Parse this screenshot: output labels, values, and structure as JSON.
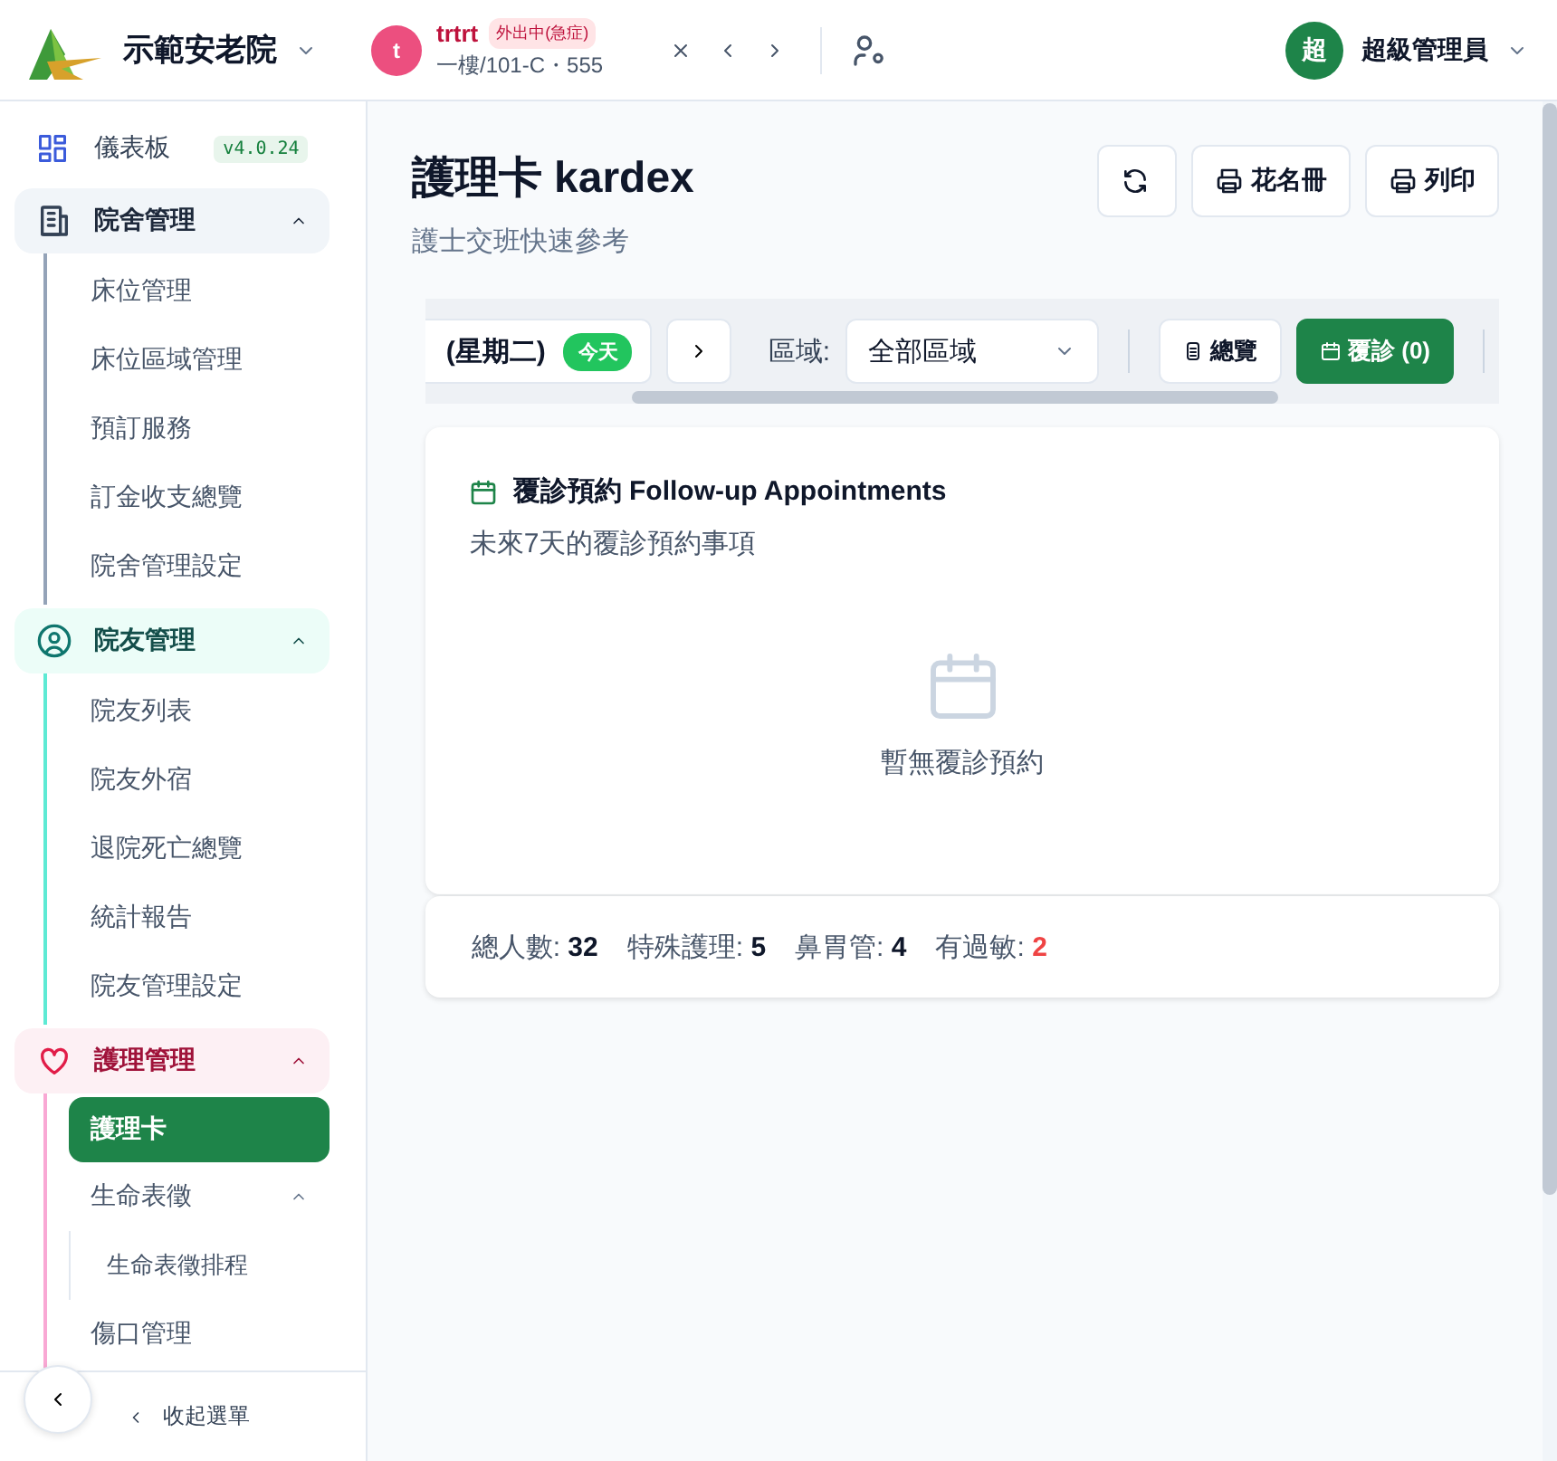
{
  "header": {
    "org_name": "示範安老院",
    "patient": {
      "avatar": "t",
      "name": "trtrt",
      "status": "外出中(急症)",
      "location": "一樓/101-C・555"
    },
    "user": {
      "avatar": "超",
      "name": "超級管理員"
    }
  },
  "sidebar": {
    "items": [
      {
        "kind": "link",
        "label": "儀表板",
        "badge": "v4.0.24"
      },
      {
        "kind": "group",
        "label": "院舍管理",
        "expanded": true,
        "color": "#94a3b8",
        "children": [
          {
            "label": "床位管理",
            "selected": false
          },
          {
            "label": "床位區域管理",
            "selected": false
          },
          {
            "label": "預訂服務",
            "selected": false
          },
          {
            "label": "訂金收支總覽",
            "selected": false
          },
          {
            "label": "院舍管理設定",
            "selected": false
          }
        ]
      },
      {
        "kind": "group",
        "label": "院友管理",
        "expanded": true,
        "color": "#5eead4",
        "children": [
          {
            "label": "院友列表",
            "selected": false
          },
          {
            "label": "院友外宿",
            "selected": false
          },
          {
            "label": "退院死亡總覽",
            "selected": false
          },
          {
            "label": "統計報告",
            "selected": false
          },
          {
            "label": "院友管理設定",
            "selected": false
          }
        ]
      },
      {
        "kind": "group",
        "label": "護理管理",
        "expanded": true,
        "color": "#f9a8d4",
        "children": [
          {
            "label": "護理卡",
            "selected": true
          },
          {
            "label": "生命表徵",
            "selected": false,
            "expanded": true,
            "children": [
              {
                "label": "生命表徵排程",
                "selected": false
              }
            ]
          },
          {
            "label": "傷口管理",
            "selected": false
          }
        ]
      }
    ],
    "collapse_label": "收起選單"
  },
  "page": {
    "title": "護理卡 kardex",
    "subtitle": "護士交班快速參考",
    "actions": [
      {
        "kind": "refresh"
      },
      {
        "kind": "print",
        "label": "花名冊"
      },
      {
        "kind": "print",
        "label": "列印"
      }
    ]
  },
  "toolbar": {
    "date": "(星期二)",
    "today_badge": "今天",
    "area_label": "區域:",
    "area_value": "全部區域",
    "views": [
      {
        "kind": "list",
        "label": "總覽",
        "selected": false
      },
      {
        "kind": "calendar",
        "label": "覆診 (0)",
        "selected": true
      }
    ]
  },
  "card": {
    "title": "覆診預約 Follow-up Appointments",
    "subtitle": "未來7天的覆診預約事項",
    "empty_text": "暫無覆診預約"
  },
  "stats": [
    {
      "label": "總人數:",
      "value": "32",
      "alert": false
    },
    {
      "label": "特殊護理:",
      "value": "5",
      "alert": false
    },
    {
      "label": "鼻胃管:",
      "value": "4",
      "alert": false
    },
    {
      "label": "有過敏:",
      "value": "2",
      "alert": true
    }
  ]
}
